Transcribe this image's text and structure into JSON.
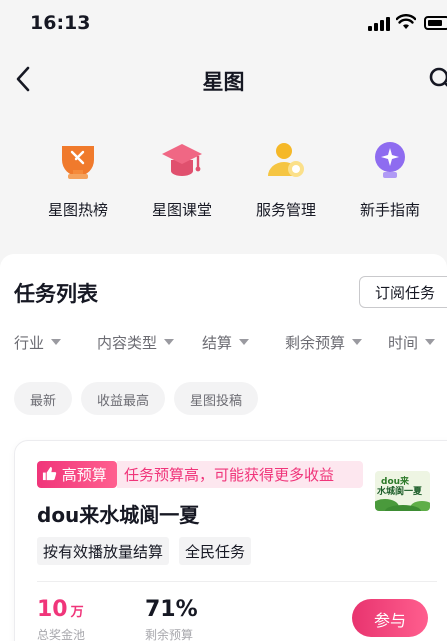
{
  "status": {
    "time": "16:13"
  },
  "nav": {
    "title": "星图"
  },
  "quick_links": [
    {
      "label": "星图热榜",
      "icon": "trophy-icon"
    },
    {
      "label": "星图课堂",
      "icon": "graduation-cap-icon"
    },
    {
      "label": "服务管理",
      "icon": "user-service-icon"
    },
    {
      "label": "新手指南",
      "icon": "lightbulb-icon"
    }
  ],
  "task_list": {
    "title": "任务列表",
    "subscribe_label": "订阅任务",
    "filters": [
      "行业",
      "内容类型",
      "结算",
      "剩余预算",
      "时间"
    ],
    "chips": [
      "最新",
      "收益最高",
      "星图投稿"
    ]
  },
  "task": {
    "tag": "高预算",
    "tag_desc": "任务预算高，可能获得更多收益",
    "title": "dou来水城阆一夏",
    "badges": [
      "按有效播放量结算",
      "全民任务"
    ],
    "prize_value": "10",
    "prize_unit": "万",
    "prize_label": "总奖金池",
    "budget_value": "71%",
    "budget_label": "剩余预算",
    "join_label": "参与",
    "thumb_top_text": "dou来",
    "thumb_text": "水城阆一夏"
  },
  "colors": {
    "accent": "#f0357a",
    "accent_bg": "#fde7ef",
    "text_primary": "#161823",
    "text_secondary": "#6c6c73"
  }
}
